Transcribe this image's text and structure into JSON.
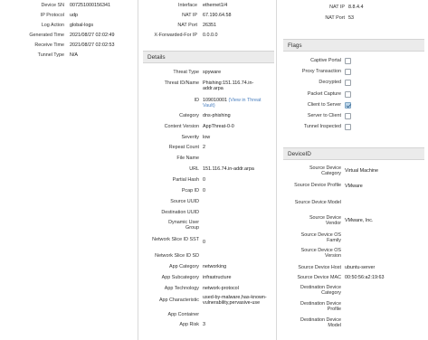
{
  "left": {
    "rows": [
      {
        "label": "Device SN",
        "value": "007251000156341"
      },
      {
        "label": "IP Protocol",
        "value": "udp"
      },
      {
        "label": "Log Action",
        "value": "global-logs"
      },
      {
        "label": "Generated Time",
        "value": "2021/08/27 02:02:49"
      },
      {
        "label": "Receive Time",
        "value": "2021/08/27 02:02:53"
      },
      {
        "label": "Tunnel Type",
        "value": "N/A"
      }
    ]
  },
  "middle_top": {
    "rows": [
      {
        "label": "Interface",
        "value": "ethernet1/4"
      },
      {
        "label": "NAT IP",
        "value": "67.190.64.58"
      },
      {
        "label": "NAT Port",
        "value": "26351"
      },
      {
        "label": "X-Forwarded-For IP",
        "value": "0.0.0.0"
      }
    ]
  },
  "details": {
    "title": "Details",
    "rows": [
      {
        "label": "Threat Type",
        "value": "spyware"
      },
      {
        "label": "Threat ID/Name",
        "value": "Phishing:151.116.74.in-addr.arpa"
      },
      {
        "label": "ID",
        "value": "109010001",
        "link": "(View in Threat Vault)"
      },
      {
        "label": "Category",
        "value": "dns-phishing"
      },
      {
        "label": "Content Version",
        "value": "AppThreat-0-0"
      },
      {
        "label": "Severity",
        "value": "low"
      },
      {
        "label": "Repeat Count",
        "value": "2"
      },
      {
        "label": "File Name",
        "value": ""
      },
      {
        "label": "URL",
        "value": "151.116.74.in-addr.arpa"
      },
      {
        "label": "Partial Hash",
        "value": "0"
      },
      {
        "label": "Pcap ID",
        "value": "0"
      },
      {
        "label": "Source UUID",
        "value": ""
      },
      {
        "label": "Destination UUID",
        "value": ""
      },
      {
        "label": "Dynamic User Group",
        "value": ""
      },
      {
        "label": "Network Slice ID SST",
        "value": "0"
      },
      {
        "label": "Network Slice ID SD",
        "value": ""
      },
      {
        "label": "App Category",
        "value": "networking"
      },
      {
        "label": "App Subcategory",
        "value": "infrastructure"
      },
      {
        "label": "App Technology",
        "value": "network-protocol"
      },
      {
        "label": "App Characteristic",
        "value": "used-by-malware,has-known-vulnerability,pervasive-use"
      },
      {
        "label": "App Container",
        "value": ""
      },
      {
        "label": "App Risk",
        "value": "3"
      }
    ]
  },
  "right_top": {
    "rows": [
      {
        "label": "NAT IP",
        "value": "8.8.4.4"
      },
      {
        "label": "NAT Port",
        "value": "53"
      }
    ]
  },
  "flags": {
    "title": "Flags",
    "items": [
      {
        "label": "Captive Portal",
        "checked": false
      },
      {
        "label": "Proxy Transaction",
        "checked": false
      },
      {
        "label": "Decrypted",
        "checked": false
      },
      {
        "label": "Packet Capture",
        "checked": false
      },
      {
        "label": "Client to Server",
        "checked": true
      },
      {
        "label": "Server to Client",
        "checked": false
      },
      {
        "label": "Tunnel Inspected",
        "checked": false
      }
    ]
  },
  "device_id": {
    "title": "DeviceID",
    "rows": [
      {
        "label": "Source Device Category",
        "value": "Virtual Machine"
      },
      {
        "label": "Source Device Profile",
        "value": "VMware"
      },
      {
        "label": "Source Device Model",
        "value": ""
      },
      {
        "label": "Source Device Vendor",
        "value": "VMware, Inc."
      },
      {
        "label": "Source Device OS Family",
        "value": ""
      },
      {
        "label": "Source Device OS Version",
        "value": ""
      },
      {
        "label": "Source Device Host",
        "value": "ubuntu-server"
      },
      {
        "label": "Source Device MAC",
        "value": "00:50:56:a2:19:63"
      },
      {
        "label": "Destination Device Category",
        "value": ""
      },
      {
        "label": "Destination Device Profile",
        "value": ""
      },
      {
        "label": "Destination Device Model",
        "value": ""
      }
    ]
  },
  "colors": {
    "panel_header_bg": "#ebebeb",
    "link": "#4a7fbf",
    "checkbox_checked": "#bfd7ea"
  }
}
